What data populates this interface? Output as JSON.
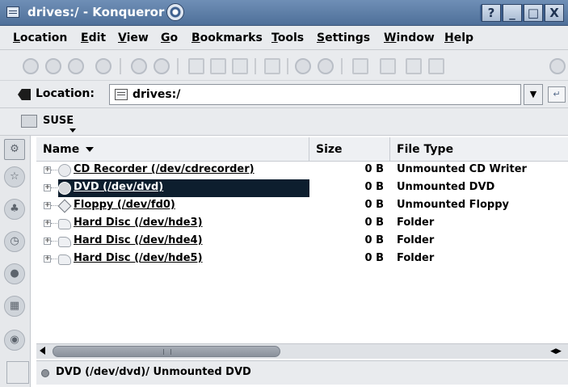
{
  "window": {
    "title": "drives:/ - Konqueror",
    "controls": [
      "?",
      "_",
      "□",
      "X"
    ]
  },
  "menu": {
    "items": [
      {
        "label": "Location",
        "mnemonic": "L"
      },
      {
        "label": "Edit",
        "mnemonic": "E"
      },
      {
        "label": "View",
        "mnemonic": "V"
      },
      {
        "label": "Go",
        "mnemonic": "G"
      },
      {
        "label": "Bookmarks",
        "mnemonic": "B"
      },
      {
        "label": "Tools",
        "mnemonic": "T"
      },
      {
        "label": "Settings",
        "mnemonic": "S"
      },
      {
        "label": "Window",
        "mnemonic": "W"
      },
      {
        "label": "Help",
        "mnemonic": "H"
      }
    ]
  },
  "toolbar": {
    "buttons": [
      "up",
      "back",
      "forward",
      "home",
      "reload",
      "stop",
      "cut",
      "copy",
      "paste",
      "print",
      "zoom-in",
      "zoom-out",
      "icon-view",
      "tree-view",
      "show-image",
      "detailed-list"
    ]
  },
  "location": {
    "label": "Location:",
    "value": "drives:/"
  },
  "bookmarks": {
    "folder": "SUSE"
  },
  "sidebar": {
    "tabs": [
      "configuration",
      "bookmarks",
      "network",
      "history",
      "devices",
      "media",
      "services"
    ]
  },
  "listview": {
    "columns": [
      "Name",
      "Size",
      "File Type"
    ],
    "rows": [
      {
        "name": "CD Recorder (/dev/cdrecorder)",
        "size": "0 B",
        "type": "Unmounted CD Writer",
        "icon": "cd-writer-icon",
        "selected": false
      },
      {
        "name": "DVD (/dev/dvd)",
        "size": "0 B",
        "type": "Unmounted DVD",
        "icon": "dvd-icon",
        "selected": true
      },
      {
        "name": "Floppy (/dev/fd0)",
        "size": "0 B",
        "type": "Unmounted Floppy",
        "icon": "floppy-icon",
        "selected": false
      },
      {
        "name": "Hard Disc (/dev/hde3)",
        "size": "0 B",
        "type": "Folder",
        "icon": "hard-disk-icon",
        "selected": false
      },
      {
        "name": "Hard Disc (/dev/hde4)",
        "size": "0 B",
        "type": "Folder",
        "icon": "hard-disk-icon",
        "selected": false
      },
      {
        "name": "Hard Disc (/dev/hde5)",
        "size": "0 B",
        "type": "Folder",
        "icon": "hard-disk-icon",
        "selected": false
      }
    ]
  },
  "status": {
    "text": "DVD (/dev/dvd)/  Unmounted DVD"
  },
  "colors": {
    "titlebar": "#4e6f99",
    "selection": "#0d1e2e",
    "chrome": "#e9ebee"
  }
}
